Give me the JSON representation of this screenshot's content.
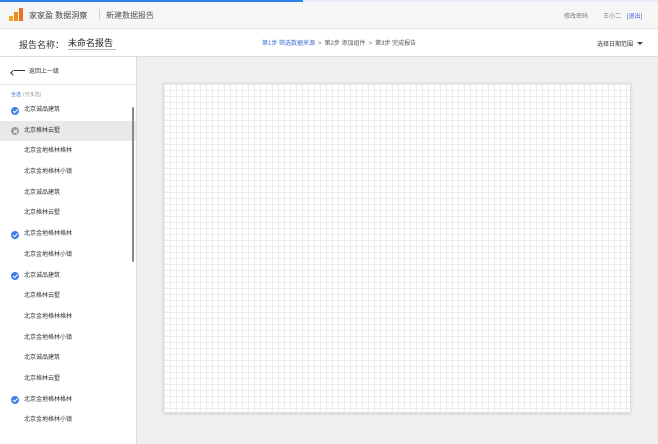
{
  "header": {
    "brand": "家家盈 数据洞察",
    "page_title": "新建数据报告",
    "change_password": "修改密码",
    "user": "王小二",
    "logout": "[退出]",
    "loading_progress": 0.46
  },
  "report": {
    "name_label": "报告名称：",
    "name_value": "未命名报告",
    "steps": [
      {
        "label": "第1步 筛选数据来源",
        "active": true
      },
      {
        "label": "第2步 添加组件",
        "active": false
      },
      {
        "label": "第3步 完成报告",
        "active": false
      }
    ],
    "step_separator": ">",
    "date_range": "选择日期范围"
  },
  "sidebar": {
    "back": "返回上一级",
    "select_all": "全选",
    "multi_hint": "(可多选)",
    "items": [
      {
        "label": "北京诚品建筑",
        "state": "checked"
      },
      {
        "label": "北京格林云墅",
        "state": "hover"
      },
      {
        "label": "北京金地格林格林",
        "state": "none"
      },
      {
        "label": "北京金地格林小镇",
        "state": "none"
      },
      {
        "label": "北京诚品建筑",
        "state": "none"
      },
      {
        "label": "北京格林云墅",
        "state": "none"
      },
      {
        "label": "北京金地格林格林",
        "state": "checked"
      },
      {
        "label": "北京金地格林小镇",
        "state": "none"
      },
      {
        "label": "北京诚品建筑",
        "state": "checked"
      },
      {
        "label": "北京格林云墅",
        "state": "none"
      },
      {
        "label": "北京金地格林格林",
        "state": "none"
      },
      {
        "label": "北京金地格林小镇",
        "state": "none"
      },
      {
        "label": "北京诚品建筑",
        "state": "none"
      },
      {
        "label": "北京格林云墅",
        "state": "none"
      },
      {
        "label": "北京金地格林格林",
        "state": "checked"
      },
      {
        "label": "北京金地格林小镇",
        "state": "none"
      }
    ]
  },
  "colors": {
    "accent": "#3f6fd8",
    "check": "#3d7ee6",
    "logo_bars": [
      "#f5a623",
      "#f08c1e",
      "#e8731a"
    ]
  }
}
